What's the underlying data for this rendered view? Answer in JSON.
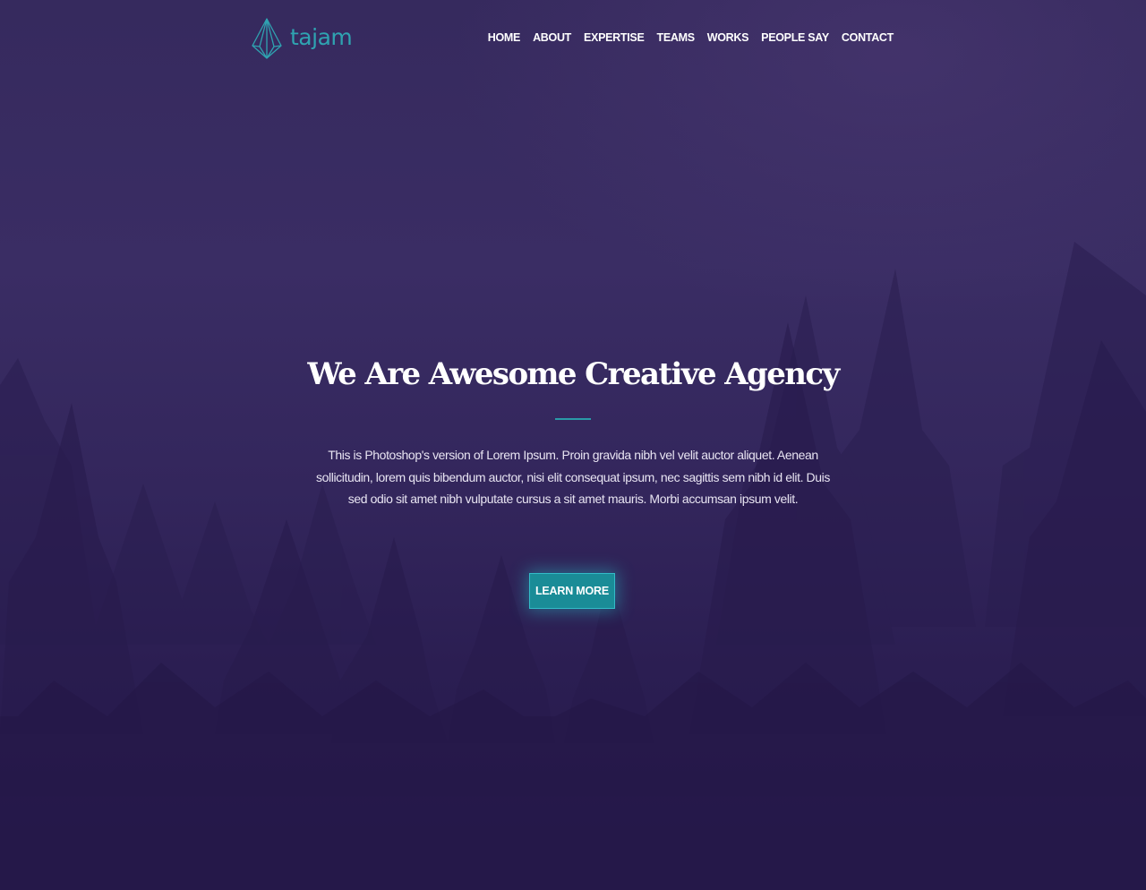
{
  "brand": {
    "name": "tajam",
    "logo_icon": "paper-plane-icon",
    "color": "#2fa3b1"
  },
  "nav": {
    "items": [
      {
        "label": "HOME"
      },
      {
        "label": "ABOUT"
      },
      {
        "label": "EXPERTISE"
      },
      {
        "label": "TEAMS"
      },
      {
        "label": "WORKS"
      },
      {
        "label": "PEOPLE SAY"
      },
      {
        "label": "CONTACT"
      }
    ]
  },
  "hero": {
    "headline": "We Are Awesome Creative Agency",
    "description": "This is Photoshop's version of Lorem Ipsum. Proin gravida nibh vel velit auctor aliquet. Aenean sollicitudin, lorem quis bibendum auctor, nisi elit consequat ipsum, nec sagittis sem nibh id elit. Duis sed odio sit amet nibh vulputate cursus a sit amet mauris. Morbi accumsan ipsum velit.",
    "cta_label": "LEARN MORE",
    "background": "forest-image"
  },
  "colors": {
    "accent": "#1a8c97",
    "background": "#32265a",
    "text": "#ffffff"
  }
}
